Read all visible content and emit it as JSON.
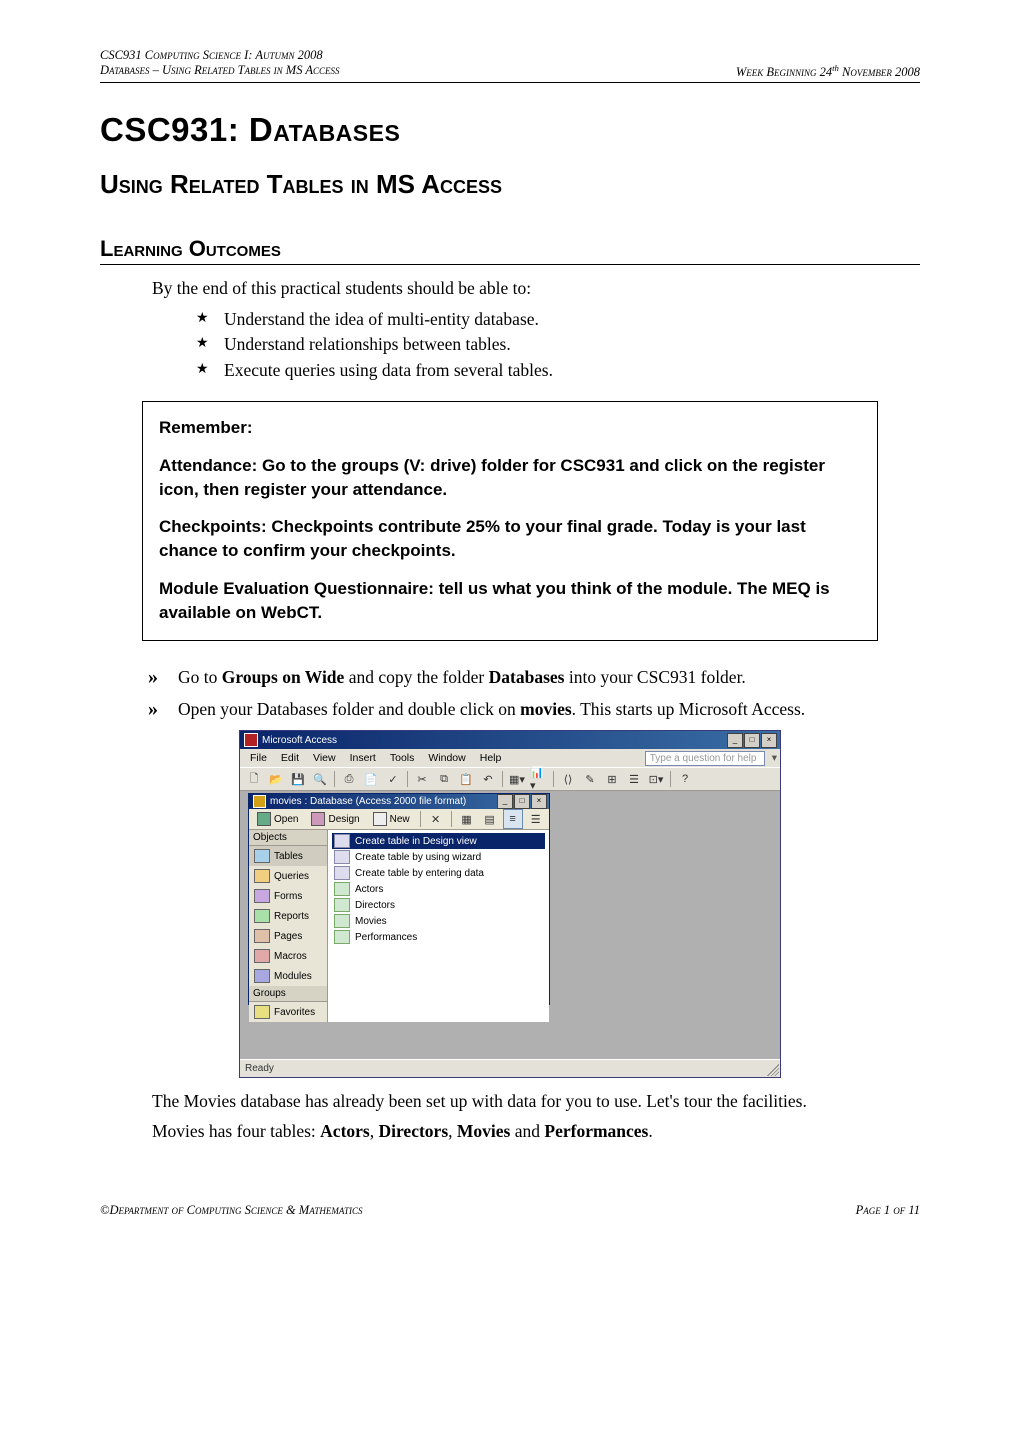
{
  "running_header": {
    "line1_left": "CSC931 Computing Science I: Autumn 2008",
    "line2_left": "Databases – Using Related Tables in MS Access",
    "line2_right_prefix": "Week Beginning 24",
    "line2_right_super": "th",
    "line2_right_suffix": " November 2008"
  },
  "title": "CSC931: Databases",
  "subtitle": "Using Related Tables in MS Access",
  "section_learning": "Learning Outcomes",
  "intro_line": "By the end of this practical students should be able to:",
  "outcomes": [
    "Understand the idea of multi-entity database.",
    "Understand relationships between tables.",
    "Execute queries using data from several tables."
  ],
  "remember": {
    "heading": "Remember:",
    "attendance_label": "Attendance: ",
    "attendance_text": "Go to the groups (V: drive) folder for CSC931 and click on the register icon, then register your attendance.",
    "checkpoints_label": "Checkpoints:  ",
    "checkpoints_text": "Checkpoints contribute 25% to your final grade. Today is your last chance to confirm your checkpoints.",
    "meq_label": "Module Evaluation Questionnaire: ",
    "meq_text": "tell us what you think of the module. The MEQ is available on WebCT."
  },
  "steps": {
    "step1_pre": "Go to ",
    "step1_bold1": "Groups on Wide",
    "step1_mid": " and copy the folder ",
    "step1_bold2": "Databases",
    "step1_post": " into your CSC931 folder.",
    "step2_pre": "Open your Databases folder and double click on ",
    "step2_bold": "movies",
    "step2_post": ". This starts up Microsoft Access."
  },
  "screenshot": {
    "app_title": "Microsoft Access",
    "menu": [
      "File",
      "Edit",
      "View",
      "Insert",
      "Tools",
      "Window",
      "Help"
    ],
    "help_hint": "Type a question for help",
    "db_title": "movies : Database (Access 2000 file format)",
    "db_toolbar": {
      "open": "Open",
      "design": "Design",
      "new": "New"
    },
    "sidebar_header_objects": "Objects",
    "sidebar_items": [
      "Tables",
      "Queries",
      "Forms",
      "Reports",
      "Pages",
      "Macros",
      "Modules"
    ],
    "sidebar_header_groups": "Groups",
    "sidebar_favorites": "Favorites",
    "list_shortcuts": [
      "Create table in Design view",
      "Create table by using wizard",
      "Create table by entering data"
    ],
    "list_tables": [
      "Actors",
      "Directors",
      "Movies",
      "Performances"
    ],
    "status": "Ready"
  },
  "after_shot_p1": "The Movies database has already been set up with data for you to use. Let's tour the facilities.",
  "after_shot_p2_pre": "Movies has four tables: ",
  "after_shot_p2_b1": "Actors",
  "after_shot_p2_s1": ", ",
  "after_shot_p2_b2": "Directors",
  "after_shot_p2_s2": ", ",
  "after_shot_p2_b3": "Movies",
  "after_shot_p2_s3": " and ",
  "after_shot_p2_b4": "Performances",
  "after_shot_p2_s4": ".",
  "footer": {
    "left_prefix": "©",
    "left": "Department of Computing Science & Mathematics",
    "right": "Page 1 of 11"
  }
}
